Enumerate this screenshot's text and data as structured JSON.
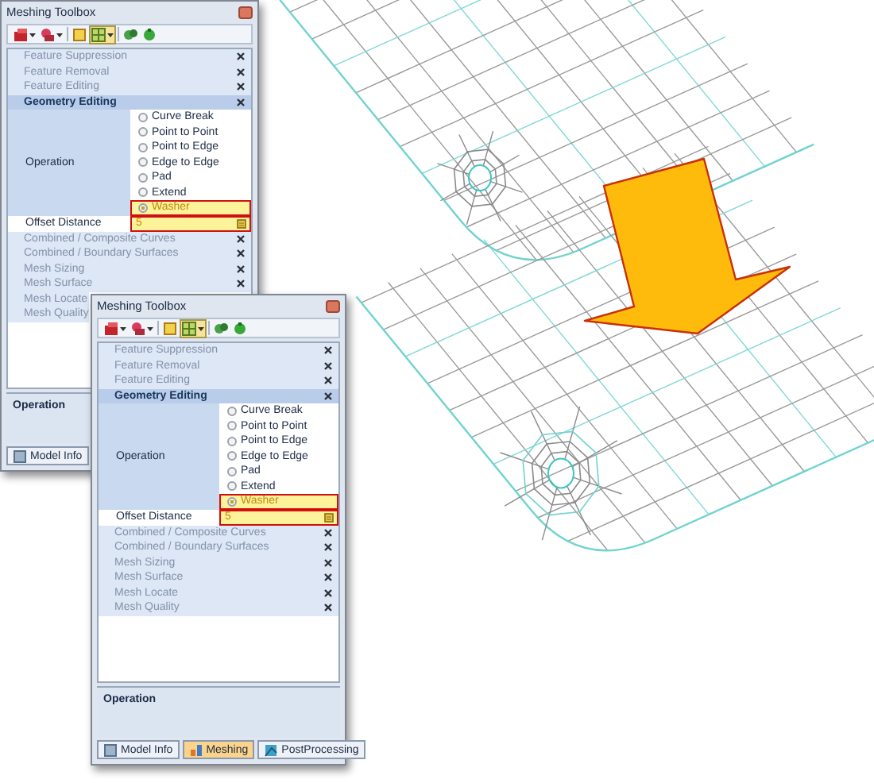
{
  "windows": [
    {
      "title": "Meshing Toolbox",
      "sections": [
        {
          "label": "Feature Suppression",
          "expanded": false,
          "closable": true
        },
        {
          "label": "Feature Removal",
          "expanded": false,
          "closable": true
        },
        {
          "label": "Feature Editing",
          "expanded": false,
          "closable": true
        },
        {
          "label": "Geometry Editing",
          "expanded": true,
          "closable": true,
          "fields": [
            {
              "kind": "radio",
              "label": "Operation",
              "options": [
                {
                  "label": "Curve Break",
                  "selected": false,
                  "highlighted": false
                },
                {
                  "label": "Point to Point",
                  "selected": false,
                  "highlighted": false
                },
                {
                  "label": "Point to Edge",
                  "selected": false,
                  "highlighted": false
                },
                {
                  "label": "Edge to Edge",
                  "selected": false,
                  "highlighted": false
                },
                {
                  "label": "Pad",
                  "selected": false,
                  "highlighted": false
                },
                {
                  "label": "Extend",
                  "selected": false,
                  "highlighted": false
                },
                {
                  "label": "Washer",
                  "selected": true,
                  "highlighted": true
                }
              ]
            },
            {
              "kind": "text",
              "label": "Offset Distance",
              "value": "5",
              "highlighted": true
            }
          ]
        },
        {
          "label": "Combined / Composite Curves",
          "expanded": false,
          "closable": true
        },
        {
          "label": "Combined / Boundary Surfaces",
          "expanded": false,
          "closable": true
        },
        {
          "label": "Mesh Sizing",
          "expanded": false,
          "closable": true
        },
        {
          "label": "Mesh Surface",
          "expanded": false,
          "closable": true
        },
        {
          "label": "Mesh Locate",
          "expanded": false,
          "closable": false
        },
        {
          "label": "Mesh Quality",
          "expanded": false,
          "closable": false
        }
      ],
      "info_panel": {
        "title": "Operation"
      },
      "tabs": [
        {
          "label": "Model Info",
          "selected": false
        }
      ]
    },
    {
      "title": "Meshing Toolbox",
      "sections": [
        {
          "label": "Feature Suppression",
          "expanded": false,
          "closable": true
        },
        {
          "label": "Feature Removal",
          "expanded": false,
          "closable": true
        },
        {
          "label": "Feature Editing",
          "expanded": false,
          "closable": true
        },
        {
          "label": "Geometry Editing",
          "expanded": true,
          "closable": true,
          "fields": [
            {
              "kind": "radio",
              "label": "Operation",
              "options": [
                {
                  "label": "Curve Break",
                  "selected": false,
                  "highlighted": false
                },
                {
                  "label": "Point to Point",
                  "selected": false,
                  "highlighted": false
                },
                {
                  "label": "Point to Edge",
                  "selected": false,
                  "highlighted": false
                },
                {
                  "label": "Edge to Edge",
                  "selected": false,
                  "highlighted": false
                },
                {
                  "label": "Pad",
                  "selected": false,
                  "highlighted": false
                },
                {
                  "label": "Extend",
                  "selected": false,
                  "highlighted": false
                },
                {
                  "label": "Washer",
                  "selected": true,
                  "highlighted": true
                }
              ]
            },
            {
              "kind": "text",
              "label": "Offset Distance",
              "value": "5",
              "highlighted": true
            }
          ]
        },
        {
          "label": "Combined / Composite Curves",
          "expanded": false,
          "closable": true
        },
        {
          "label": "Combined / Boundary Surfaces",
          "expanded": false,
          "closable": true
        },
        {
          "label": "Mesh Sizing",
          "expanded": false,
          "closable": true
        },
        {
          "label": "Mesh Surface",
          "expanded": false,
          "closable": true
        },
        {
          "label": "Mesh Locate",
          "expanded": false,
          "closable": true
        },
        {
          "label": "Mesh Quality",
          "expanded": false,
          "closable": true
        }
      ],
      "info_panel": {
        "title": "Operation"
      },
      "tabs": [
        {
          "label": "Model Info",
          "selected": false
        },
        {
          "label": "Meshing",
          "selected": true
        },
        {
          "label": "PostProcessing",
          "selected": false
        }
      ]
    }
  ]
}
